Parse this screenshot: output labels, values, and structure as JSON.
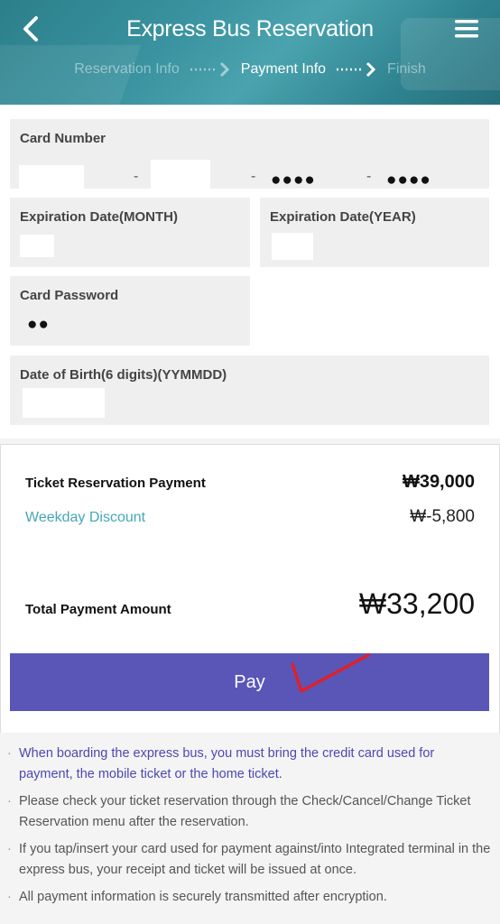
{
  "header": {
    "title": "Express Bus Reservation",
    "steps": [
      {
        "label": "Reservation Info",
        "state": "done"
      },
      {
        "label": "Payment Info",
        "state": "active"
      },
      {
        "label": "Finish",
        "state": "pending"
      }
    ],
    "back_icon": "chevron-left-icon",
    "menu_icon": "hamburger-menu-icon"
  },
  "form": {
    "card_number": {
      "label": "Card Number",
      "part1": "",
      "part2": "",
      "separator": "-",
      "part3": "●●●●",
      "part4": "●●●●"
    },
    "expiry_month": {
      "label": "Expiration Date(MONTH)",
      "value": ""
    },
    "expiry_year": {
      "label": "Expiration Date(YEAR)",
      "value": ""
    },
    "card_password": {
      "label": "Card Password",
      "value": "●●"
    },
    "dob": {
      "label": "Date of Birth(6 digits)(YYMMDD)",
      "value": ""
    }
  },
  "summary": {
    "ticket_label": "Ticket Reservation Payment",
    "ticket_amount": "₩39,000",
    "discount_label": "Weekday Discount",
    "discount_amount": "₩-5,800",
    "total_label": "Total Payment Amount",
    "total_amount": "₩33,200"
  },
  "pay_button": {
    "label": "Pay"
  },
  "notes": [
    {
      "text": "When boarding the express bus, you must bring the credit card used for payment, the mobile ticket or the home ticket.",
      "highlight": true
    },
    {
      "text": "Please check your ticket reservation through the Check/Cancel/Change Ticket Reservation menu after the reservation.",
      "highlight": false
    },
    {
      "text": "If you tap/insert your card used for payment against/into Integrated terminal in the express bus, your receipt and ticket will be issued at once.",
      "highlight": false
    },
    {
      "text": "All payment information is securely transmitted after encryption.",
      "highlight": false
    }
  ],
  "colors": {
    "header_teal": "#3a93a0",
    "pay_button": "#5956b8",
    "discount_text": "#45a7b9",
    "highlight_note": "#4b48b0",
    "checkmark": "#e0202a"
  }
}
